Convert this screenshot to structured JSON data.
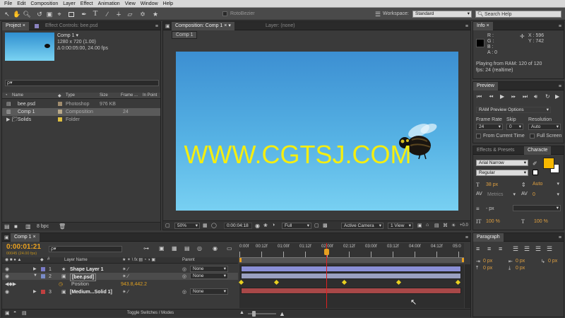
{
  "menu": [
    "File",
    "Edit",
    "Composition",
    "Layer",
    "Effect",
    "Animation",
    "View",
    "Window",
    "Help"
  ],
  "toolbar": {
    "roto_label": "RotoBezier",
    "workspace_label": "Workspace:",
    "workspace_value": "Standard",
    "search_placeholder": "Search Help"
  },
  "project": {
    "tab": "Project",
    "effect_tab": "Effect Controls: bee.psd",
    "comp_name": "Comp 1 ▾",
    "comp_size": "1280 x 720 (1.00)",
    "comp_duration": "Δ 0:00:05:00, 24.00 fps",
    "search": "ρ▾",
    "headers": [
      "Name",
      "Type",
      "Size",
      "Frame ...",
      "In Point"
    ],
    "rows": [
      {
        "name": "bee.psd",
        "type": "Photoshop",
        "size": "976 KB",
        "fps": "",
        "color": "#a08c6e"
      },
      {
        "name": "Comp 1",
        "type": "Composition",
        "size": "",
        "fps": "24",
        "color": "#b9a98a"
      },
      {
        "name": "Solids",
        "type": "Folder",
        "size": "",
        "fps": "",
        "color": "#e0c040"
      }
    ],
    "bpc": "8 bpc"
  },
  "composition": {
    "tab": "Composition: Comp 1",
    "layer_tab": "Layer: (none)",
    "subtab": "Comp 1",
    "watermark": "WWW.CGTSJ.COM",
    "zoom": "50%",
    "time": "0:00:04:18",
    "resolution": "Full",
    "camera": "Active Camera",
    "views": "1 View",
    "offset": "+0.0"
  },
  "info": {
    "tab": "Info",
    "r": "R :",
    "g": "G :",
    "b": "B :",
    "a": "A : 0",
    "x": "X : 596",
    "y": "Y : 742",
    "status1": "Playing from RAM: 120 of 120",
    "status2": "fps: 24 (realtime)"
  },
  "preview": {
    "tab": "Preview",
    "ram_option": "RAM Preview Options",
    "frame_rate_label": "Frame Rate",
    "skip_label": "Skip",
    "resolution_label": "Resolution",
    "frame_rate": "24",
    "skip": "0",
    "resolution": "Auto",
    "from_current": "From Current Time",
    "full_screen": "Full Screen"
  },
  "character": {
    "tab1": "Effects & Presets",
    "tab2": "Characte",
    "font": "Arial Narrow",
    "style": "Regular",
    "size": "38 px",
    "leading": "Auto",
    "kerning": "Metrics",
    "tracking": "0",
    "stroke": "- px",
    "scale_v": "100 %",
    "scale_h": "100 %",
    "fill_color": "#f7b800"
  },
  "paragraph": {
    "tab": "Paragraph",
    "v1": "0 px",
    "v2": "0 px",
    "v3": "0 px",
    "v4": "0 px",
    "v5": "0 px"
  },
  "timeline": {
    "tab": "Comp 1",
    "timecode": "0:00:01:21",
    "frames": "00045 (24.00 fps)",
    "search": "ρ▾",
    "header_name": "Layer Name",
    "header_parent": "Parent",
    "toggle": "Toggle Switches / Modes",
    "ruler": [
      "0:00f",
      "00:12f",
      "01:00f",
      "01:12f",
      "02:00f",
      "02:12f",
      "03:00f",
      "03:12f",
      "04:00f",
      "04:12f",
      "05:0"
    ],
    "playhead_fraction": 0.3833,
    "layers": [
      {
        "num": "1",
        "name": "Shape Layer 1",
        "color": "#7b7bc7",
        "parent": "None",
        "bar": "#8a8fd6",
        "star": true
      },
      {
        "num": "2",
        "name": "[bee.psd]",
        "color": "#7a8cc8",
        "parent": "None",
        "bar": "#9aa0c0",
        "star": false
      },
      {
        "num": "3",
        "name": "[Medium...Solid 1]",
        "color": "#c04040",
        "parent": "None",
        "bar": "#a84848",
        "star": false
      }
    ],
    "property": {
      "name": "Position",
      "value": "943.8,442.2"
    },
    "keyframes": [
      0.0,
      0.16,
      0.47,
      0.72,
      0.99
    ]
  }
}
